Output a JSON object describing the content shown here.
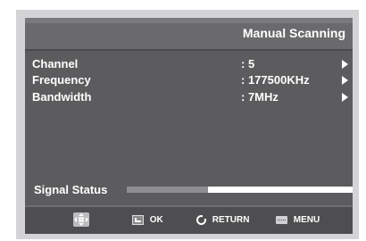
{
  "header": {
    "title": "Manual Scanning"
  },
  "rows": [
    {
      "label": "Channel",
      "value": ": 5"
    },
    {
      "label": "Frequency",
      "value": ": 177500KHz"
    },
    {
      "label": "Bandwidth",
      "value": ": 7MHz"
    }
  ],
  "signal": {
    "label": "Signal Status",
    "level": 0.36
  },
  "footer": {
    "move_icon": "move-arrows-icon",
    "ok": {
      "icon": "ok-icon",
      "label": "OK"
    },
    "return": {
      "icon": "return-icon",
      "label": "RETURN"
    },
    "menu": {
      "icon": "menu-icon",
      "label": "MENU"
    }
  },
  "colors": {
    "panel": "#5c5c5e",
    "header": "#6a6a6c",
    "footer": "#4e4e50",
    "bar_fill": "#8e8e90",
    "bar_track": "#ffffff"
  }
}
